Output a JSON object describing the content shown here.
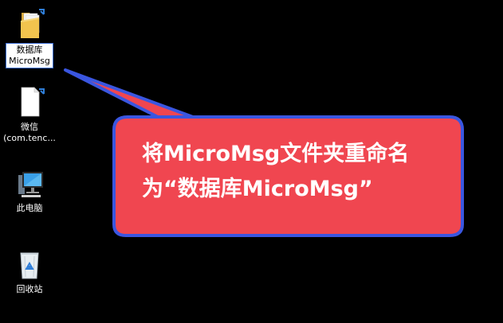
{
  "desktop": {
    "icons": [
      {
        "name": "database-folder",
        "label": "数据库\nMicroMsg",
        "icon": "folder-icon",
        "selected": true
      },
      {
        "name": "wechat-file",
        "label": "微信\n(com.tenc...",
        "icon": "file-icon",
        "selected": false
      },
      {
        "name": "this-pc",
        "label": "此电脑",
        "icon": "computer-icon",
        "selected": false
      },
      {
        "name": "recycle-bin",
        "label": "回收站",
        "icon": "recycle-bin-icon",
        "selected": false
      }
    ]
  },
  "callout": {
    "line1": "将MicroMsg文件夹重命名",
    "line2": "为“数据库MicroMsg”",
    "fill_color": "#f04650",
    "border_color": "#3a56e0"
  }
}
